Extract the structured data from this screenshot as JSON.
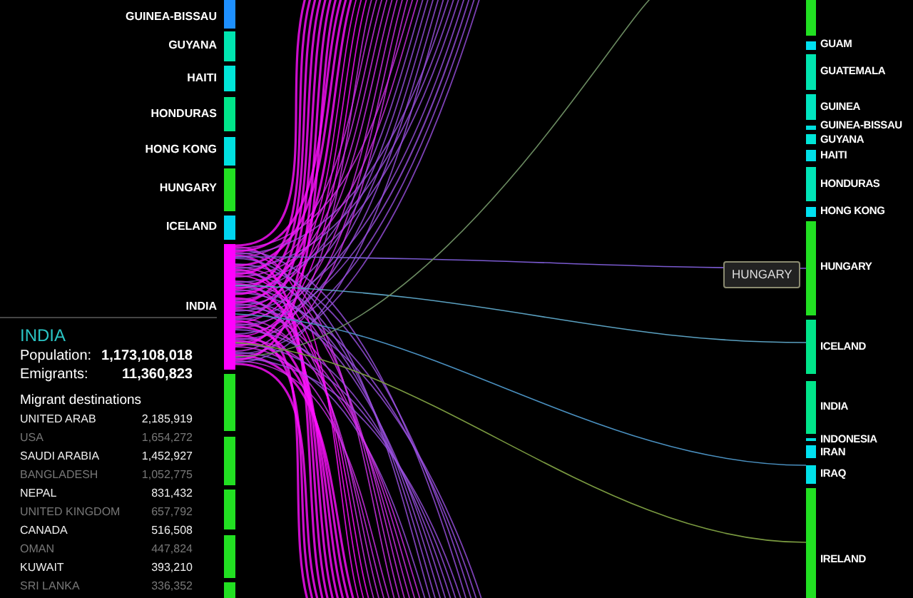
{
  "left_nodes": [
    {
      "label": "GUINEA-BISSAU",
      "color": "#1e90ff"
    },
    {
      "label": "GUYANA",
      "color": "#00e5b0"
    },
    {
      "label": "HAITI",
      "color": "#00e5d8"
    },
    {
      "label": "HONDURAS",
      "color": "#00e58a"
    },
    {
      "label": "HONG KONG",
      "color": "#00e0e0"
    },
    {
      "label": "HUNGARY",
      "color": "#22e022"
    },
    {
      "label": "ICELAND",
      "color": "#00d4f0"
    },
    {
      "label": "INDIA",
      "color": "#ff00ff"
    }
  ],
  "right_nodes": [
    {
      "label": "GUAM",
      "color": "#00e0f0"
    },
    {
      "label": "GUATEMALA",
      "color": "#00e5b0"
    },
    {
      "label": "GUINEA",
      "color": "#00e5c0"
    },
    {
      "label": "GUINEA-BISSAU",
      "color": "#00e0e0"
    },
    {
      "label": "GUYANA",
      "color": "#00e5d8"
    },
    {
      "label": "HAITI",
      "color": "#00e0e8"
    },
    {
      "label": "HONDURAS",
      "color": "#00e5b8"
    },
    {
      "label": "HONG KONG",
      "color": "#00e0f0"
    },
    {
      "label": "HUNGARY",
      "color": "#22e022"
    },
    {
      "label": "ICELAND",
      "color": "#00e58a"
    },
    {
      "label": "INDIA",
      "color": "#00e58a"
    },
    {
      "label": "INDONESIA",
      "color": "#00e0e0"
    },
    {
      "label": "IRAN",
      "color": "#00e0f0"
    },
    {
      "label": "IRAQ",
      "color": "#00e0e8"
    },
    {
      "label": "IRELAND",
      "color": "#22e022"
    }
  ],
  "tooltip": "HUNGARY",
  "info_panel": {
    "country": "INDIA",
    "population_label": "Population:",
    "population": "1,173,108,018",
    "emigrants_label": "Emigrants:",
    "emigrants": "11,360,823",
    "destinations_title": "Migrant destinations",
    "destinations": [
      {
        "name": "UNITED ARAB",
        "value": "2,185,919"
      },
      {
        "name": "USA",
        "value": "1,654,272"
      },
      {
        "name": "SAUDI ARABIA",
        "value": "1,452,927"
      },
      {
        "name": "BANGLADESH",
        "value": "1,052,775"
      },
      {
        "name": "NEPAL",
        "value": "831,432"
      },
      {
        "name": "UNITED KINGDOM",
        "value": "657,792"
      },
      {
        "name": "CANADA",
        "value": "516,508"
      },
      {
        "name": "OMAN",
        "value": "447,824"
      },
      {
        "name": "KUWAIT",
        "value": "393,210"
      },
      {
        "name": "SRI LANKA",
        "value": "336,352"
      }
    ]
  }
}
